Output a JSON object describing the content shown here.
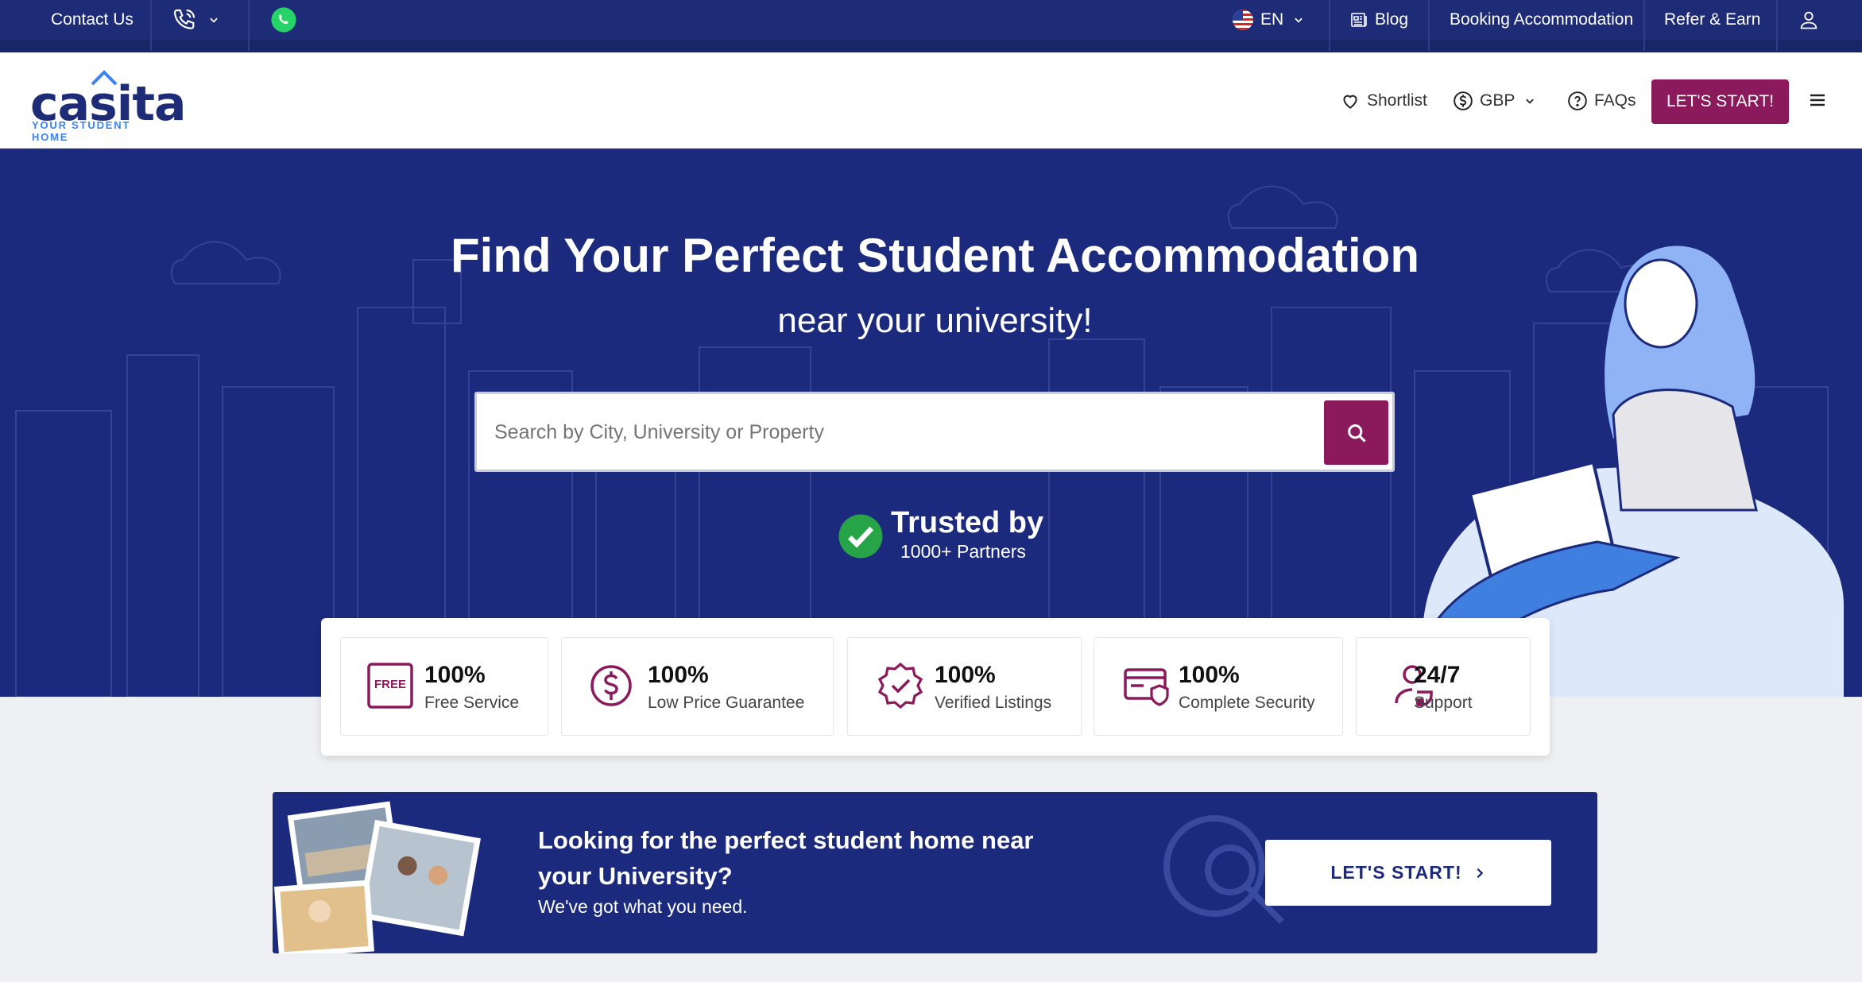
{
  "topbar": {
    "contact": "Contact Us",
    "language": "EN",
    "blog": "Blog",
    "booking": "Booking Accommodation",
    "refer": "Refer & Earn"
  },
  "header": {
    "logo_text": "casita",
    "logo_tagline": "YOUR STUDENT HOME",
    "shortlist": "Shortlist",
    "currency": "GBP",
    "faqs": "FAQs",
    "start_button": "LET'S START!"
  },
  "hero": {
    "title": "Find Your Perfect Student Accommodation",
    "subtitle": "near your university!",
    "search_placeholder": "Search by City, University or Property",
    "trust_title": "Trusted by",
    "trust_sub": "1000+ Partners"
  },
  "features": [
    {
      "value": "100%",
      "label": "Free Service",
      "icon": "free-icon"
    },
    {
      "value": "100%",
      "label": "Low Price Guarantee",
      "icon": "dollar-icon"
    },
    {
      "value": "100%",
      "label": "Verified Listings",
      "icon": "verified-badge-icon"
    },
    {
      "value": "100%",
      "label": "Complete Security",
      "icon": "secure-card-icon"
    },
    {
      "value": "24/7",
      "label": "Support",
      "icon": "support-icon"
    }
  ],
  "free_icon_text": "FREE",
  "banner": {
    "heading": "Looking for the perfect student home near your University?",
    "sub": "We've got what you need.",
    "button": "LET'S START!"
  },
  "colors": {
    "navy": "#1c2a7d",
    "accent": "#8b1a5c",
    "whatsapp": "#25d366"
  }
}
